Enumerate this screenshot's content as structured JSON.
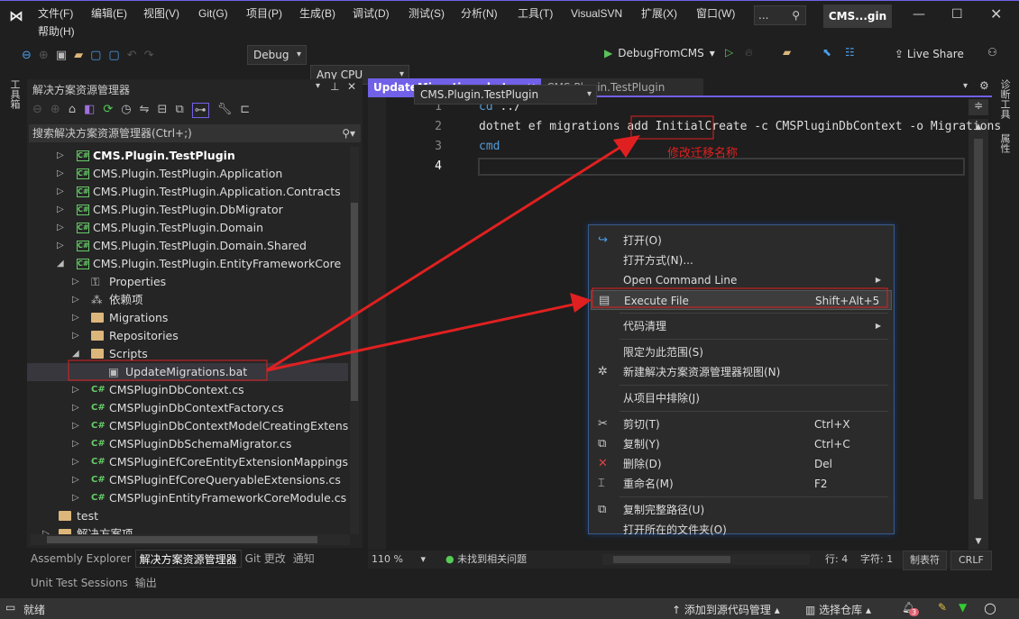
{
  "menu": [
    "文件(F)",
    "编辑(E)",
    "视图(V)",
    "Git(G)",
    "项目(P)",
    "生成(B)",
    "调试(D)",
    "测试(S)",
    "分析(N)",
    "工具(T)",
    "VisualSVN",
    "扩展(X)",
    "窗口(W)",
    "帮助(H)"
  ],
  "search_box": "...",
  "window_title": "CMS...gin",
  "toolbar": {
    "config": "Debug",
    "platform": "Any CPU",
    "startup_project": "CMS.Plugin.TestPlugin",
    "run_target": "DebugFromCMS",
    "live_share": "Live Share"
  },
  "left_strip": "工具箱",
  "right_strip": [
    "诊断工具",
    "属性"
  ],
  "solution_explorer": {
    "title": "解决方案资源管理器",
    "search_placeholder": "搜索解决方案资源管理器(Ctrl+;)",
    "items": [
      {
        "label": "CMS.Plugin.TestPlugin",
        "icon": "csharp-project",
        "level": 0,
        "state": "collapsed",
        "bold": true
      },
      {
        "label": "CMS.Plugin.TestPlugin.Application",
        "icon": "csharp-project",
        "level": 0,
        "state": "collapsed"
      },
      {
        "label": "CMS.Plugin.TestPlugin.Application.Contracts",
        "icon": "csharp-project",
        "level": 0,
        "state": "collapsed"
      },
      {
        "label": "CMS.Plugin.TestPlugin.DbMigrator",
        "icon": "csharp-project",
        "level": 0,
        "state": "collapsed"
      },
      {
        "label": "CMS.Plugin.TestPlugin.Domain",
        "icon": "csharp-project",
        "level": 0,
        "state": "collapsed"
      },
      {
        "label": "CMS.Plugin.TestPlugin.Domain.Shared",
        "icon": "csharp-project",
        "level": 0,
        "state": "collapsed"
      },
      {
        "label": "CMS.Plugin.TestPlugin.EntityFrameworkCore",
        "icon": "csharp-project",
        "level": 0,
        "state": "expanded"
      },
      {
        "label": "Properties",
        "icon": "properties",
        "level": 1,
        "state": "collapsed"
      },
      {
        "label": "依赖项",
        "icon": "dependencies",
        "level": 1,
        "state": "collapsed"
      },
      {
        "label": "Migrations",
        "icon": "folder",
        "level": 1,
        "state": "collapsed"
      },
      {
        "label": "Repositories",
        "icon": "folder",
        "level": 1,
        "state": "collapsed"
      },
      {
        "label": "Scripts",
        "icon": "folder",
        "level": 1,
        "state": "expanded"
      },
      {
        "label": "UpdateMigrations.bat",
        "icon": "bat-file",
        "level": 2,
        "state": "none",
        "selected": true
      },
      {
        "label": "CMSPluginDbContext.cs",
        "icon": "csharp-file",
        "level": 1,
        "state": "collapsed"
      },
      {
        "label": "CMSPluginDbContextFactory.cs",
        "icon": "csharp-file",
        "level": 1,
        "state": "collapsed"
      },
      {
        "label": "CMSPluginDbContextModelCreatingExtension",
        "icon": "csharp-file",
        "level": 1,
        "state": "collapsed"
      },
      {
        "label": "CMSPluginDbSchemaMigrator.cs",
        "icon": "csharp-file",
        "level": 1,
        "state": "collapsed"
      },
      {
        "label": "CMSPluginEfCoreEntityExtensionMappings.cs",
        "icon": "csharp-file",
        "level": 1,
        "state": "collapsed"
      },
      {
        "label": "CMSPluginEfCoreQueryableExtensions.cs",
        "icon": "csharp-file",
        "level": 1,
        "state": "collapsed"
      },
      {
        "label": "CMSPluginEntityFrameworkCoreModule.cs",
        "icon": "csharp-file",
        "level": 1,
        "state": "collapsed"
      },
      {
        "label": "test",
        "icon": "folder",
        "level": -1,
        "state": "none"
      },
      {
        "label": "解决方案项",
        "icon": "folder",
        "level": -1,
        "state": "collapsed"
      }
    ],
    "bottom_tabs": [
      "Assembly Explorer",
      "解决方案资源管理器",
      "Git 更改",
      "通知"
    ],
    "bottom_tabs2": [
      "Unit Test Sessions",
      "输出"
    ]
  },
  "editor": {
    "tabs": [
      "UpdateMigrations.bat",
      "CMS.Plugin.TestPlugin"
    ],
    "lines": [
      {
        "n": "1",
        "kw": "cd",
        "rest": " ../"
      },
      {
        "n": "2",
        "kw": "",
        "rest": "dotnet ef migrations add ",
        "hl": "InitialCreate",
        "after": " -c CMSPluginDbContext -o Migrations"
      },
      {
        "n": "3",
        "kw": "cmd",
        "rest": ""
      },
      {
        "n": "4",
        "kw": "",
        "rest": ""
      }
    ],
    "annotation": "修改迁移名称",
    "annotation_color": "#e02020",
    "zoom": "110 %",
    "issues": "未找到相关问题",
    "line": "行: 4",
    "char": "字符: 1",
    "tabs_mode": "制表符",
    "eol": "CRLF"
  },
  "context_menu": [
    {
      "label": "打开(O)",
      "icon": "open-icon"
    },
    {
      "label": "打开方式(N)..."
    },
    {
      "label": "Open Command Line",
      "submenu": true
    },
    {
      "label": "Execute File",
      "shortcut": "Shift+Alt+5",
      "icon": "console-icon",
      "highlighted": true
    },
    {
      "sep": true
    },
    {
      "label": "代码清理",
      "submenu": true
    },
    {
      "sep": true
    },
    {
      "label": "限定为此范围(S)"
    },
    {
      "label": "新建解决方案资源管理器视图(N)",
      "icon": "new-view-icon"
    },
    {
      "sep": true
    },
    {
      "label": "从项目中排除(J)"
    },
    {
      "sep": true
    },
    {
      "label": "剪切(T)",
      "shortcut": "Ctrl+X",
      "icon": "cut-icon"
    },
    {
      "label": "复制(Y)",
      "shortcut": "Ctrl+C",
      "icon": "copy-icon"
    },
    {
      "label": "删除(D)",
      "shortcut": "Del",
      "icon": "delete-icon"
    },
    {
      "label": "重命名(M)",
      "shortcut": "F2",
      "icon": "rename-icon"
    },
    {
      "sep": true
    },
    {
      "label": "复制完整路径(U)",
      "icon": "copy-path-icon"
    },
    {
      "label": "打开所在的文件夹(O)"
    }
  ],
  "statusbar": {
    "ready": "就绪",
    "add_source": "添加到源代码管理",
    "select_repo": "选择仓库",
    "notifications": "3"
  },
  "colors": {
    "accent": "#7160e8",
    "annotation": "#e02020",
    "bg": "#1f1f1f"
  }
}
